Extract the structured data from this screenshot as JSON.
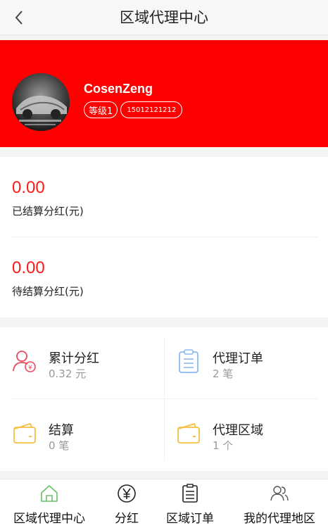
{
  "header": {
    "title": "区域代理中心"
  },
  "profile": {
    "username": "CosenZeng",
    "level": "等级1",
    "phone": "15012121212"
  },
  "settlement": {
    "settled_amount": "0.00",
    "settled_label": "已结算分红(元)",
    "pending_amount": "0.00",
    "pending_label": "待结算分红(元)"
  },
  "grid": [
    {
      "title": "累计分红",
      "sub": "0.32 元",
      "icon": "user-dividend-icon"
    },
    {
      "title": "代理订单",
      "sub": "2 笔",
      "icon": "clipboard-icon"
    },
    {
      "title": "结算",
      "sub": "0 笔",
      "icon": "wallet-icon"
    },
    {
      "title": "代理区域",
      "sub": "1 个",
      "icon": "wallet-icon"
    }
  ],
  "tabs": [
    {
      "label": "区域代理中心",
      "icon": "home-icon"
    },
    {
      "label": "分红",
      "icon": "yen-icon"
    },
    {
      "label": "区域订单",
      "icon": "list-icon"
    },
    {
      "label": "我的代理地区",
      "icon": "users-icon"
    }
  ],
  "colors": {
    "brand_red": "#ff0000",
    "amount_red": "#ff1a1a",
    "active_tab": "#4caf50",
    "wallet_yellow": "#f5c040",
    "clipboard_blue": "#8cb8f0"
  }
}
